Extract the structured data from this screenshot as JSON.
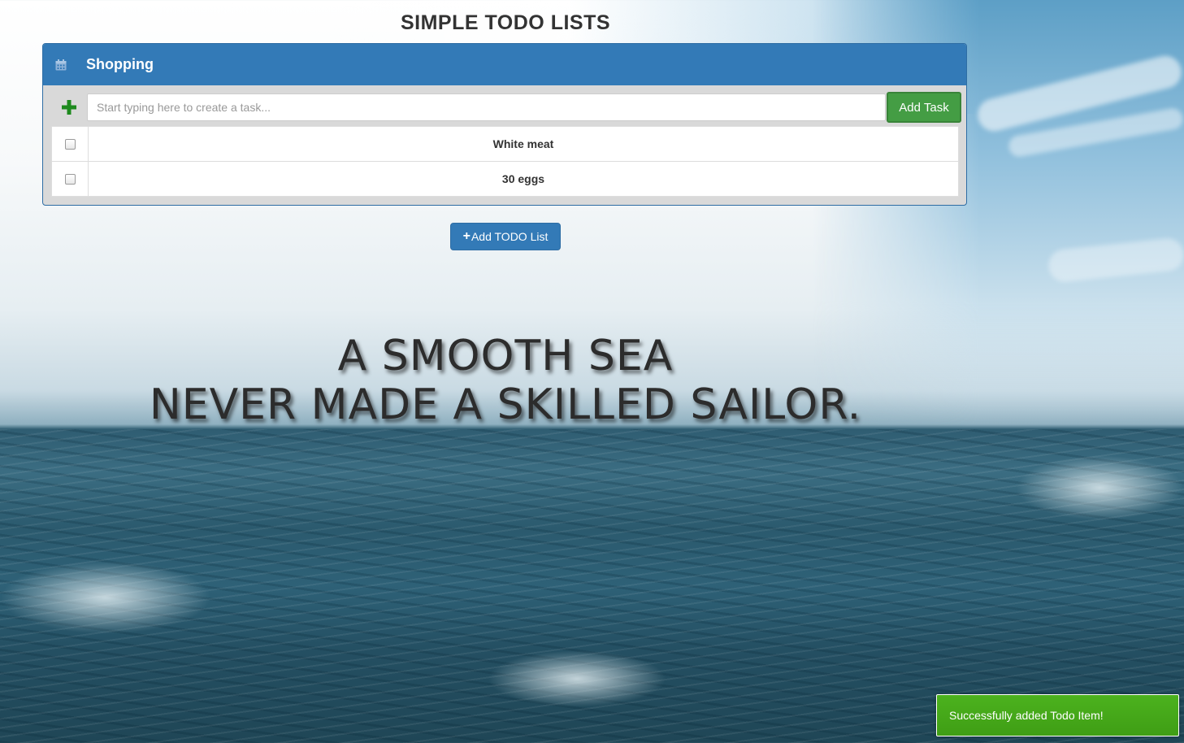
{
  "app": {
    "title": "SIMPLE TODO LISTS"
  },
  "todo_list": {
    "icon": "calendar-icon",
    "title": "Shopping",
    "add_icon": "plus-icon",
    "input_placeholder": "Start typing here to create a task...",
    "input_value": "",
    "add_task_label": "Add Task",
    "tasks": [
      {
        "text": "White meat",
        "done": false
      },
      {
        "text": "30 eggs",
        "done": false
      }
    ]
  },
  "add_list_button": {
    "icon": "+",
    "label": "Add TODO List"
  },
  "background_quote": {
    "line1": "A SMOOTH SEA",
    "line2": "NEVER MADE A SKILLED SAILOR."
  },
  "notification": {
    "message": "Successfully added Todo Item!"
  },
  "colors": {
    "primary": "#337ab7",
    "success": "#449d44",
    "toast": "#4cb21e"
  }
}
